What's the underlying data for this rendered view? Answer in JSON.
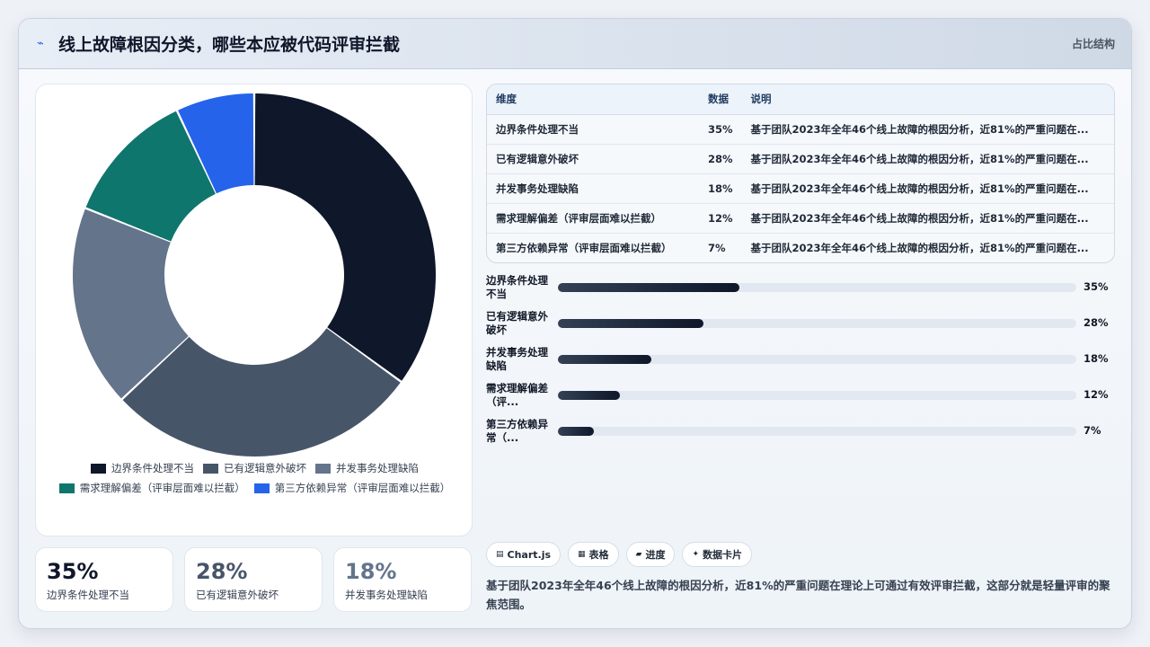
{
  "header": {
    "icon": "pulse-icon",
    "title": "线上故障根因分类，哪些本应被代码评审拦截",
    "tag": "占比结构"
  },
  "colors": {
    "c1": "#0f172a",
    "c2": "#475569",
    "c3": "#64748b",
    "c4": "#0f766e",
    "c5": "#2563eb"
  },
  "chart_data": {
    "type": "pie",
    "categories": [
      "边界条件处理不当",
      "已有逻辑意外破坏",
      "并发事务处理缺陷",
      "需求理解偏差（评审层面难以拦截）",
      "第三方依赖异常（评审层面难以拦截）"
    ],
    "values": [
      35,
      28,
      18,
      12,
      7
    ],
    "colors": [
      "#0f172a",
      "#475569",
      "#64748b",
      "#0f766e",
      "#2563eb"
    ]
  },
  "stats": [
    {
      "value": "35%",
      "label": "边界条件处理不当",
      "color": "#0f172a"
    },
    {
      "value": "28%",
      "label": "已有逻辑意外破坏",
      "color": "#475569"
    },
    {
      "value": "18%",
      "label": "并发事务处理缺陷",
      "color": "#64748b"
    }
  ],
  "table": {
    "headers": [
      "维度",
      "数据",
      "说明"
    ],
    "rows": [
      [
        "边界条件处理不当",
        "35%",
        "基于团队2023年全年46个线上故障的根因分析，近81%的严重问题在..."
      ],
      [
        "已有逻辑意外破坏",
        "28%",
        "基于团队2023年全年46个线上故障的根因分析，近81%的严重问题在..."
      ],
      [
        "并发事务处理缺陷",
        "18%",
        "基于团队2023年全年46个线上故障的根因分析，近81%的严重问题在..."
      ],
      [
        "需求理解偏差（评审层面难以拦截）",
        "12%",
        "基于团队2023年全年46个线上故障的根因分析，近81%的严重问题在..."
      ],
      [
        "第三方依赖异常（评审层面难以拦截）",
        "7%",
        "基于团队2023年全年46个线上故障的根因分析，近81%的严重问题在..."
      ]
    ]
  },
  "bars": [
    {
      "label": "边界条件处理不当",
      "value": "35%",
      "fraction": 0.35
    },
    {
      "label": "已有逻辑意外破坏",
      "value": "28%",
      "fraction": 0.28
    },
    {
      "label": "并发事务处理缺陷",
      "value": "18%",
      "fraction": 0.18
    },
    {
      "label": "需求理解偏差（评...",
      "value": "12%",
      "fraction": 0.12
    },
    {
      "label": "第三方依赖异常（...",
      "value": "7%",
      "fraction": 0.07
    }
  ],
  "chips": [
    {
      "icon": "chart-icon",
      "glyph": "▤",
      "label": "Chart.js"
    },
    {
      "icon": "table-icon",
      "glyph": "▦",
      "label": "表格"
    },
    {
      "icon": "progress-icon",
      "glyph": "▰",
      "label": "进度"
    },
    {
      "icon": "sparkle-icon",
      "glyph": "✦",
      "label": "数据卡片"
    }
  ],
  "summary": "基于团队2023年全年46个线上故障的根因分析，近81%的严重问题在理论上可通过有效评审拦截，这部分就是轻量评审的聚焦范围。"
}
